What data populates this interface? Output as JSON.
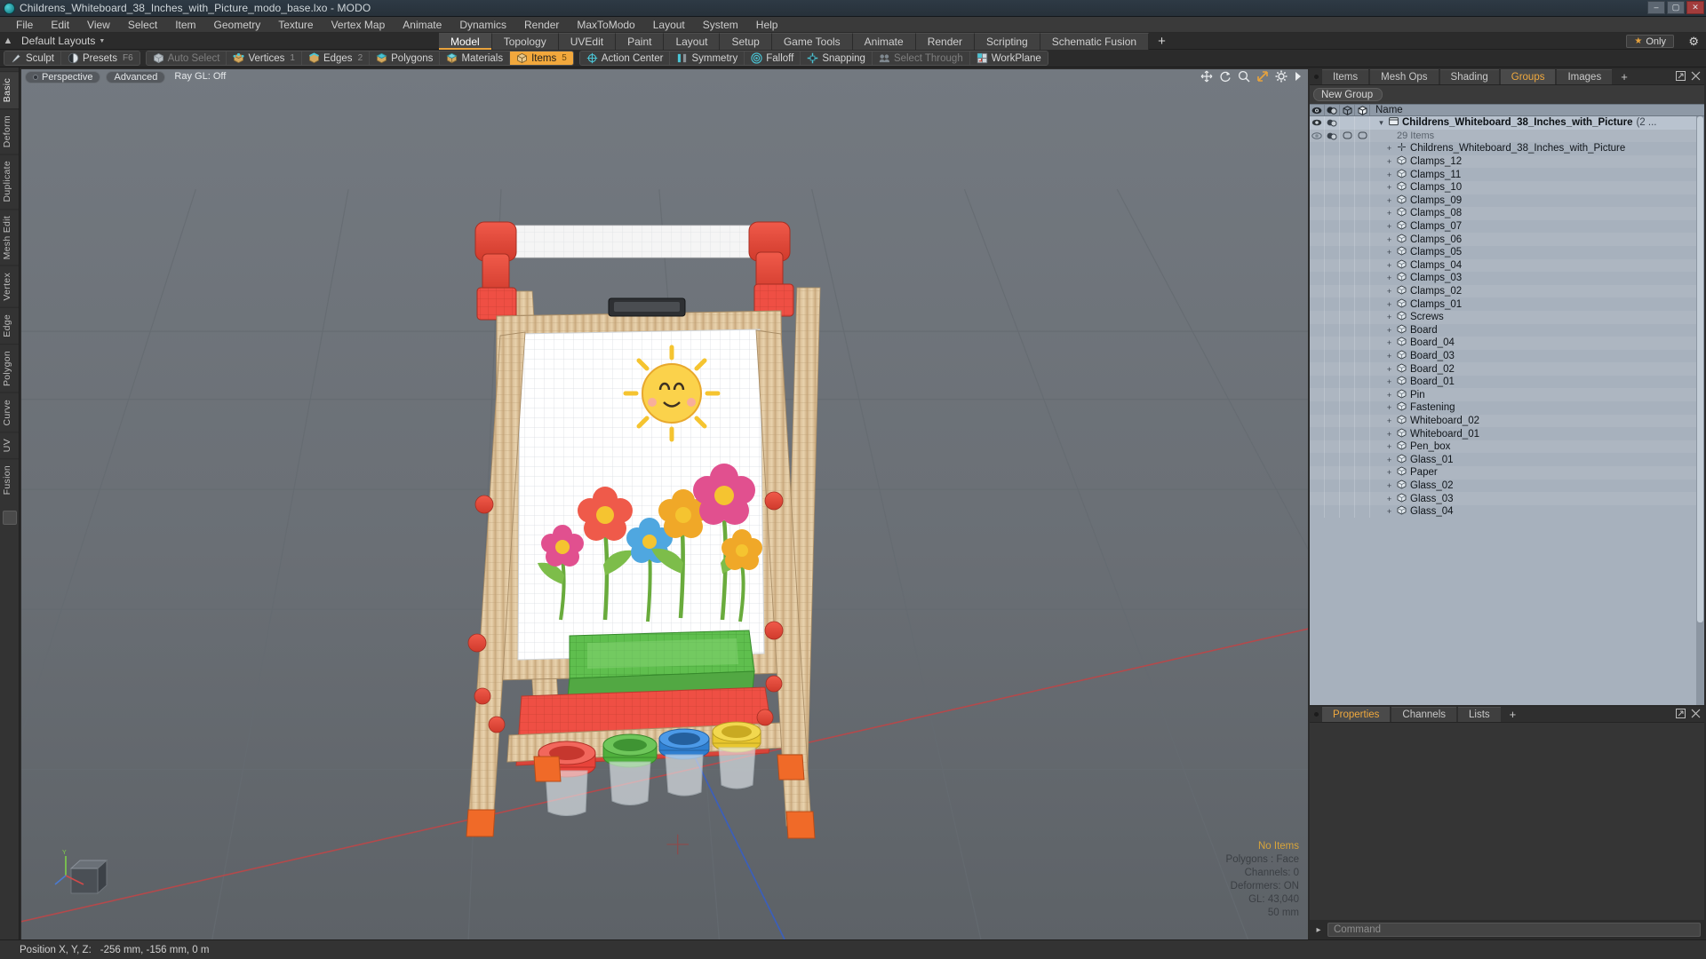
{
  "window": {
    "title": "Childrens_Whiteboard_38_Inches_with_Picture_modo_base.lxo - MODO",
    "minimize": "–",
    "maximize": "▢",
    "close": "✕"
  },
  "menubar": [
    "File",
    "Edit",
    "View",
    "Select",
    "Item",
    "Geometry",
    "Texture",
    "Vertex Map",
    "Animate",
    "Dynamics",
    "Render",
    "MaxToModo",
    "Layout",
    "System",
    "Help"
  ],
  "layout_row": {
    "home_icon": "home-icon",
    "layouts_label": "Default Layouts",
    "tabs": [
      {
        "label": "Model",
        "active": true
      },
      {
        "label": "Topology",
        "active": false
      },
      {
        "label": "UVEdit",
        "active": false
      },
      {
        "label": "Paint",
        "active": false
      },
      {
        "label": "Layout",
        "active": false
      },
      {
        "label": "Setup",
        "active": false
      },
      {
        "label": "Game Tools",
        "active": false
      },
      {
        "label": "Animate",
        "active": false
      },
      {
        "label": "Render",
        "active": false
      },
      {
        "label": "Scripting",
        "active": false
      },
      {
        "label": "Schematic Fusion",
        "active": false
      }
    ],
    "add_tab": "+",
    "only_button": "Only",
    "gear_icon": "gear-icon"
  },
  "modebar": {
    "group1": [
      {
        "label": "Sculpt",
        "icon": "sculpt-icon",
        "state": "normal",
        "num": ""
      },
      {
        "label": "Presets",
        "icon": "presets-icon",
        "state": "normal",
        "num": "F6"
      }
    ],
    "group2": [
      {
        "label": "Auto Select",
        "icon": "cube-grey-icon",
        "state": "dim",
        "num": ""
      },
      {
        "label": "Vertices",
        "icon": "cube-vertex-icon",
        "state": "normal",
        "num": "1"
      },
      {
        "label": "Edges",
        "icon": "cube-edge-icon",
        "state": "normal",
        "num": "2"
      },
      {
        "label": "Polygons",
        "icon": "cube-poly-icon",
        "state": "normal",
        "num": ""
      },
      {
        "label": "Materials",
        "icon": "cube-material-icon",
        "state": "normal",
        "num": ""
      },
      {
        "label": "Items",
        "icon": "cube-item-icon",
        "state": "on",
        "num": "5"
      }
    ],
    "group3": [
      {
        "label": "Action Center",
        "icon": "action-center-icon",
        "state": "normal",
        "num": ""
      },
      {
        "label": "Symmetry",
        "icon": "symmetry-icon",
        "state": "normal",
        "num": ""
      },
      {
        "label": "Falloff",
        "icon": "falloff-icon",
        "state": "normal",
        "num": ""
      },
      {
        "label": "Snapping",
        "icon": "snapping-icon",
        "state": "normal",
        "num": ""
      },
      {
        "label": "Select Through",
        "icon": "select-through-icon",
        "state": "dim",
        "num": ""
      },
      {
        "label": "WorkPlane",
        "icon": "workplane-icon",
        "state": "normal",
        "num": ""
      }
    ]
  },
  "left_tabs": [
    {
      "label": "Basic",
      "selected": true
    },
    {
      "label": "Deform",
      "selected": false
    },
    {
      "label": "Duplicate",
      "selected": false
    },
    {
      "label": "Mesh Edit",
      "selected": false
    },
    {
      "label": "Vertex",
      "selected": false
    },
    {
      "label": "Edge",
      "selected": false
    },
    {
      "label": "Polygon",
      "selected": false
    },
    {
      "label": "Curve",
      "selected": false
    },
    {
      "label": "UV",
      "selected": false
    },
    {
      "label": "Fusion",
      "selected": false
    }
  ],
  "viewport": {
    "perspective_label": "Perspective",
    "advanced_label": "Advanced",
    "raygl_label": "Ray GL: Off",
    "icons": [
      "move-icon",
      "rotate-icon",
      "zoom-icon",
      "fit-icon",
      "gear-icon",
      "arrow-icon"
    ],
    "stats": {
      "no_items": "No Items",
      "polygons": "Polygons : Face",
      "channels": "Channels: 0",
      "deformers": "Deformers: ON",
      "gl": "GL: 43,040",
      "scale": "50 mm"
    },
    "gizmo_axes": [
      "Y",
      "X",
      "Z"
    ]
  },
  "right_panel": {
    "tabs": [
      {
        "label": "Items",
        "active": false
      },
      {
        "label": "Mesh Ops",
        "active": false
      },
      {
        "label": "Shading",
        "active": false
      },
      {
        "label": "Groups",
        "active": true
      },
      {
        "label": "Images",
        "active": false
      },
      {
        "label": "+",
        "active": false
      }
    ],
    "new_group_button": "New Group",
    "columns": [
      "eye-icon",
      "shade-icon",
      "cube-outline-icon",
      "cube-solid-icon"
    ],
    "name_column": "Name",
    "items": [
      {
        "name": "Childrens_Whiteboard_38_Inches_with_Picture",
        "suffix": "(2 ...",
        "depth": 0,
        "type": "group",
        "selected": true,
        "bold": true,
        "eye": true
      },
      {
        "name": "29 Items",
        "depth": 1,
        "type": "count",
        "selected": false,
        "bold": false,
        "eye": false
      },
      {
        "name": "Childrens_Whiteboard_38_Inches_with_Picture",
        "depth": 1,
        "type": "locator",
        "selected": false,
        "bold": false,
        "eye": false
      },
      {
        "name": "Clamps_12",
        "depth": 1,
        "type": "mesh",
        "selected": false,
        "bold": false,
        "eye": false
      },
      {
        "name": "Clamps_11",
        "depth": 1,
        "type": "mesh",
        "selected": false,
        "bold": false,
        "eye": false
      },
      {
        "name": "Clamps_10",
        "depth": 1,
        "type": "mesh",
        "selected": false,
        "bold": false,
        "eye": false
      },
      {
        "name": "Clamps_09",
        "depth": 1,
        "type": "mesh",
        "selected": false,
        "bold": false,
        "eye": false
      },
      {
        "name": "Clamps_08",
        "depth": 1,
        "type": "mesh",
        "selected": false,
        "bold": false,
        "eye": false
      },
      {
        "name": "Clamps_07",
        "depth": 1,
        "type": "mesh",
        "selected": false,
        "bold": false,
        "eye": false
      },
      {
        "name": "Clamps_06",
        "depth": 1,
        "type": "mesh",
        "selected": false,
        "bold": false,
        "eye": false
      },
      {
        "name": "Clamps_05",
        "depth": 1,
        "type": "mesh",
        "selected": false,
        "bold": false,
        "eye": false
      },
      {
        "name": "Clamps_04",
        "depth": 1,
        "type": "mesh",
        "selected": false,
        "bold": false,
        "eye": false
      },
      {
        "name": "Clamps_03",
        "depth": 1,
        "type": "mesh",
        "selected": false,
        "bold": false,
        "eye": false
      },
      {
        "name": "Clamps_02",
        "depth": 1,
        "type": "mesh",
        "selected": false,
        "bold": false,
        "eye": false
      },
      {
        "name": "Clamps_01",
        "depth": 1,
        "type": "mesh",
        "selected": false,
        "bold": false,
        "eye": false
      },
      {
        "name": "Screws",
        "depth": 1,
        "type": "mesh",
        "selected": false,
        "bold": false,
        "eye": false
      },
      {
        "name": "Board",
        "depth": 1,
        "type": "mesh",
        "selected": false,
        "bold": false,
        "eye": false
      },
      {
        "name": "Board_04",
        "depth": 1,
        "type": "mesh",
        "selected": false,
        "bold": false,
        "eye": false
      },
      {
        "name": "Board_03",
        "depth": 1,
        "type": "mesh",
        "selected": false,
        "bold": false,
        "eye": false
      },
      {
        "name": "Board_02",
        "depth": 1,
        "type": "mesh",
        "selected": false,
        "bold": false,
        "eye": false
      },
      {
        "name": "Board_01",
        "depth": 1,
        "type": "mesh",
        "selected": false,
        "bold": false,
        "eye": false
      },
      {
        "name": "Pin",
        "depth": 1,
        "type": "mesh",
        "selected": false,
        "bold": false,
        "eye": false
      },
      {
        "name": "Fastening",
        "depth": 1,
        "type": "mesh",
        "selected": false,
        "bold": false,
        "eye": false
      },
      {
        "name": "Whiteboard_02",
        "depth": 1,
        "type": "mesh",
        "selected": false,
        "bold": false,
        "eye": false
      },
      {
        "name": "Whiteboard_01",
        "depth": 1,
        "type": "mesh",
        "selected": false,
        "bold": false,
        "eye": false
      },
      {
        "name": "Pen_box",
        "depth": 1,
        "type": "mesh",
        "selected": false,
        "bold": false,
        "eye": false
      },
      {
        "name": "Glass_01",
        "depth": 1,
        "type": "mesh",
        "selected": false,
        "bold": false,
        "eye": false
      },
      {
        "name": "Paper",
        "depth": 1,
        "type": "mesh",
        "selected": false,
        "bold": false,
        "eye": false
      },
      {
        "name": "Glass_02",
        "depth": 1,
        "type": "mesh",
        "selected": false,
        "bold": false,
        "eye": false
      },
      {
        "name": "Glass_03",
        "depth": 1,
        "type": "mesh",
        "selected": false,
        "bold": false,
        "eye": false
      },
      {
        "name": "Glass_04",
        "depth": 1,
        "type": "mesh",
        "selected": false,
        "bold": false,
        "eye": false
      }
    ],
    "bottom_tabs": [
      {
        "label": "Properties",
        "active": true
      },
      {
        "label": "Channels",
        "active": false
      },
      {
        "label": "Lists",
        "active": false
      },
      {
        "label": "+",
        "active": false
      }
    ]
  },
  "command_bar": {
    "arrow": "▸",
    "placeholder": "Command"
  },
  "statusbar": {
    "position_label": "Position X, Y, Z:",
    "position_value": "-256 mm, -156 mm, 0 m"
  },
  "colors": {
    "accent": "#f2a83c",
    "panel_bg": "#3a3a3a",
    "list_bg": "#a7b1bd",
    "viewport": "#6b7076",
    "titlebar": "#2e3a45"
  }
}
